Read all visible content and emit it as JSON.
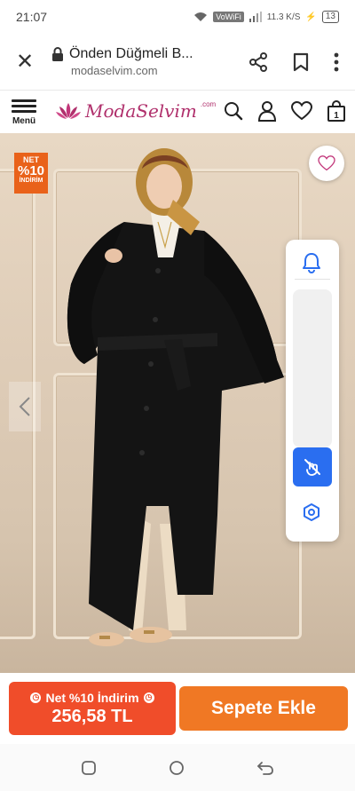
{
  "status_bar": {
    "time": "21:07",
    "network_badge": "VoWiFi",
    "data_speed": "11.3 K/S",
    "battery": "13"
  },
  "browser": {
    "page_title": "Önden Düğmeli B...",
    "url": "modaselvim.com"
  },
  "header": {
    "menu_label": "Menü",
    "logo_text": "ModaSelvim",
    "logo_suffix": ".com"
  },
  "hero": {
    "promo_badge": {
      "line1": "NET",
      "line2": "%10",
      "line3": "İNDİRİM"
    },
    "colors": {
      "coat": "#141414",
      "scarf": "#b8883a",
      "wall": "#e6d6c1"
    }
  },
  "cta": {
    "discount_label": "Net %10 İndirim",
    "discount_price": "256,58 TL",
    "add_to_cart": "Sepete Ekle"
  },
  "colors": {
    "discount_bg": "#f04d2a",
    "cart_bg": "#f07824",
    "brand": "#b0306c",
    "widget_accent": "#2a6ef0"
  }
}
